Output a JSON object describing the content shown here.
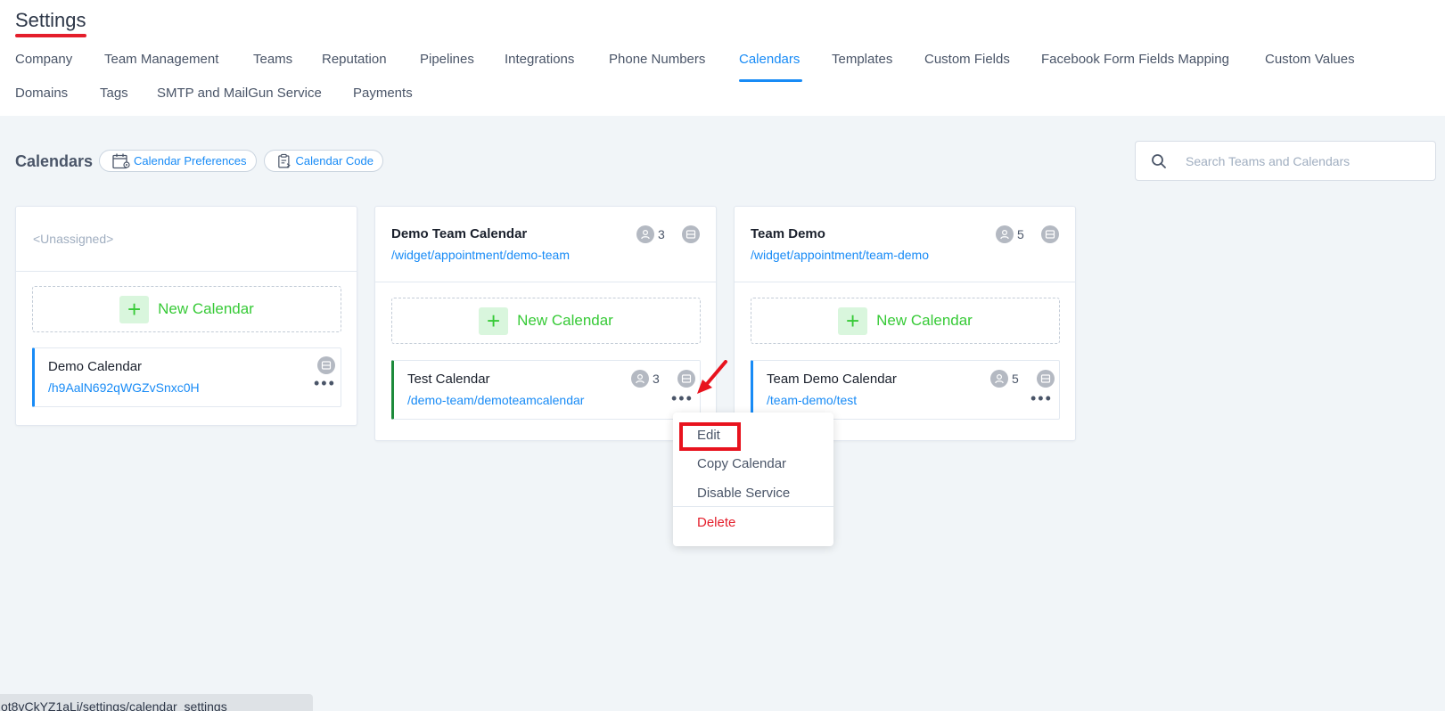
{
  "header": {
    "title": "Settings",
    "nav_tabs": [
      {
        "label": "Company"
      },
      {
        "label": "Team Management"
      },
      {
        "label": "Teams"
      },
      {
        "label": "Reputation"
      },
      {
        "label": "Pipelines"
      },
      {
        "label": "Integrations"
      },
      {
        "label": "Phone Numbers"
      },
      {
        "label": "Calendars",
        "active": true
      },
      {
        "label": "Templates"
      },
      {
        "label": "Custom Fields"
      },
      {
        "label": "Facebook Form Fields Mapping"
      },
      {
        "label": "Custom Values"
      },
      {
        "label": "Domains"
      },
      {
        "label": "Tags"
      },
      {
        "label": "SMTP and MailGun Service"
      },
      {
        "label": "Payments"
      }
    ]
  },
  "toolbar": {
    "title": "Calendars",
    "preferences_label": "Calendar Preferences",
    "code_label": "Calendar Code",
    "search_placeholder": "Search Teams and Calendars"
  },
  "columns": [
    {
      "title": "<Unassigned>",
      "new_calendar_label": "New Calendar",
      "calendars": [
        {
          "name": "Demo Calendar",
          "link": "/h9AalN692qWGZvSnxc0H"
        }
      ]
    },
    {
      "title": "Demo Team Calendar",
      "link": "/widget/appointment/demo-team",
      "member_count": "3",
      "new_calendar_label": "New Calendar",
      "calendars": [
        {
          "name": "Test Calendar",
          "link": "/demo-team/demoteamcalendar",
          "member_count": "3"
        }
      ]
    },
    {
      "title": "Team Demo",
      "link": "/widget/appointment/team-demo",
      "member_count": "5",
      "new_calendar_label": "New Calendar",
      "calendars": [
        {
          "name": "Team Demo Calendar",
          "link": "/team-demo/test",
          "member_count": "5"
        }
      ]
    }
  ],
  "context_menu": {
    "items": [
      "Edit",
      "Copy Calendar",
      "Disable Service",
      "Delete"
    ]
  },
  "status_bar": {
    "url": "ot8vCkYZ1aLj/settings/calendar_settings"
  },
  "colors": {
    "accent": "#188bf6",
    "success": "#37ca37",
    "danger": "#e41e2b",
    "annotation": "#e8131e"
  }
}
